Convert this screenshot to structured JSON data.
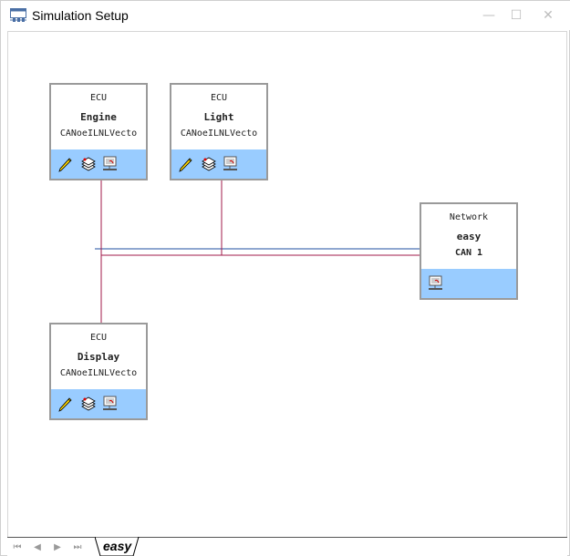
{
  "window": {
    "title": "Simulation Setup",
    "minimize": "—",
    "maximize": "☐",
    "close": "✕"
  },
  "nodes": [
    {
      "kind": "ECU",
      "name": "Engine",
      "db": "CANoeILNLVecto",
      "icons": [
        "pencil-icon",
        "stack-icon",
        "network-icon"
      ]
    },
    {
      "kind": "ECU",
      "name": "Light",
      "db": "CANoeILNLVecto",
      "icons": [
        "pencil-icon",
        "stack-icon",
        "network-icon"
      ]
    },
    {
      "kind": "ECU",
      "name": "Display",
      "db": "CANoeILNLVecto",
      "icons": [
        "pencil-icon",
        "stack-icon",
        "network-icon"
      ]
    },
    {
      "kind": "Network",
      "name": "easy",
      "db": "CAN 1",
      "icons": [
        "network-icon"
      ]
    }
  ],
  "tabs": {
    "active": "easy",
    "nav": [
      "⏮",
      "◀",
      "▶",
      "⏭"
    ]
  },
  "colors": {
    "bus_blue": "#1f4fa0",
    "bus_red": "#a01a4a",
    "footer": "#99ccff"
  }
}
